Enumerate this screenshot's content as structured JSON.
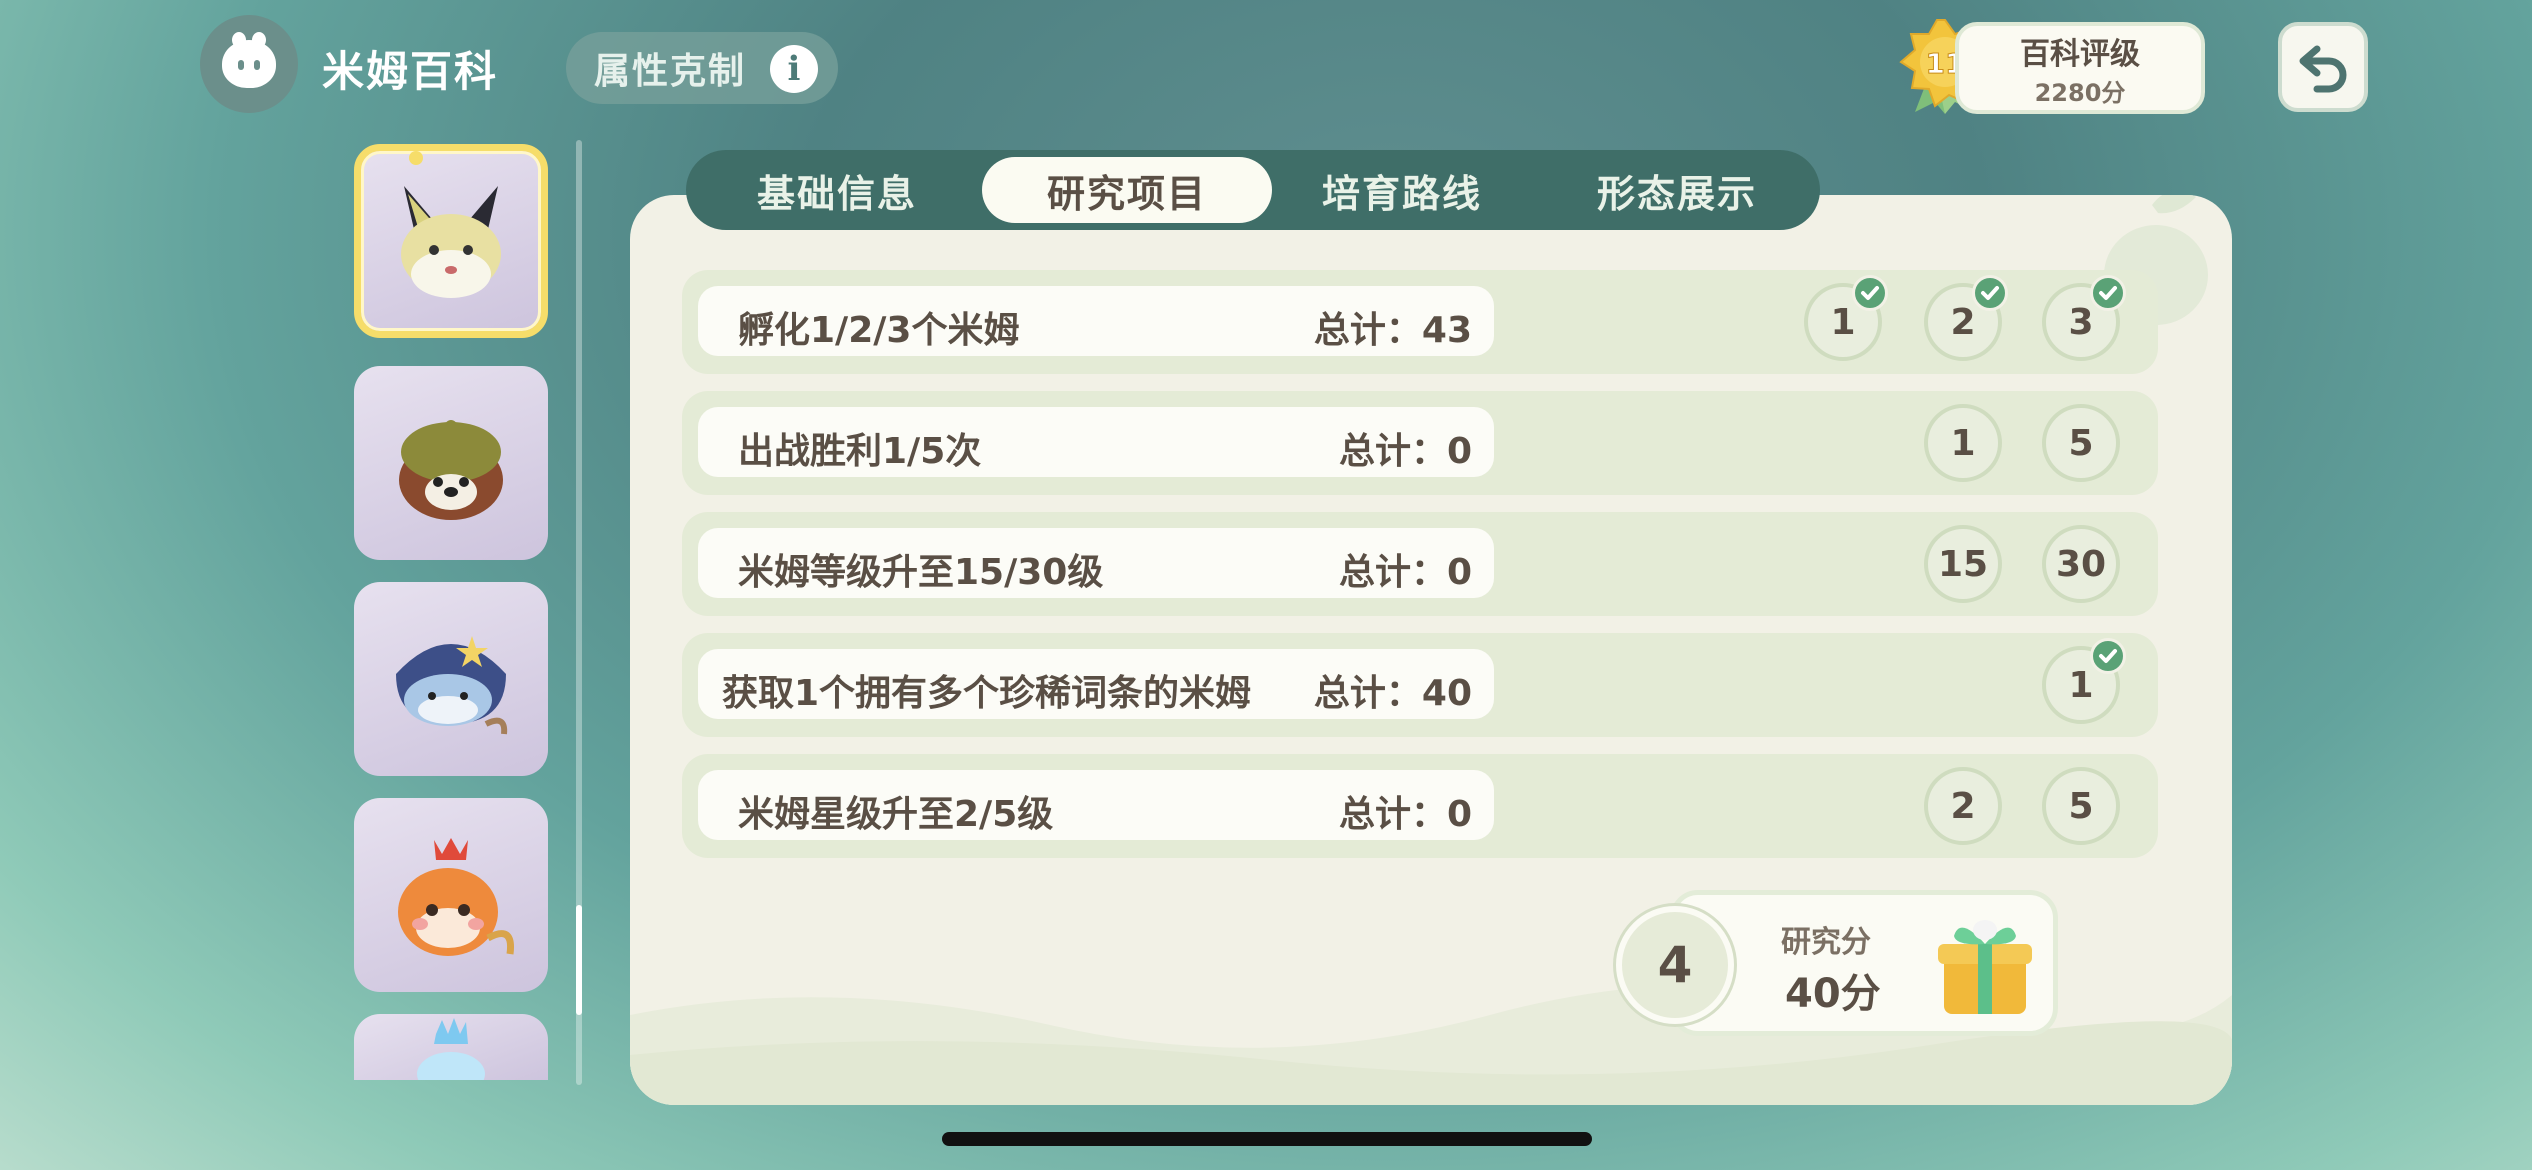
{
  "header": {
    "app_title": "米姆百科",
    "attr_button_label": "属性克制",
    "info_glyph": "i",
    "rank_level": "11",
    "rank_title": "百科评级",
    "rank_points": "2280分"
  },
  "tabs": [
    {
      "label": "基础信息",
      "active": false
    },
    {
      "label": "研究项目",
      "active": true
    },
    {
      "label": "培育路线",
      "active": false
    },
    {
      "label": "形态展示",
      "active": false
    }
  ],
  "sidebar": {
    "items": [
      {
        "name": "fox-mim",
        "selected": true
      },
      {
        "name": "leaf-bear-mim",
        "selected": false
      },
      {
        "name": "star-whale-mim",
        "selected": false
      },
      {
        "name": "crown-fox-mim",
        "selected": false
      },
      {
        "name": "ice-mim",
        "selected": false
      }
    ]
  },
  "tasks": [
    {
      "task": "孵化1/2/3个米姆",
      "total": "总计：43",
      "milestones": [
        {
          "v": "1",
          "done": true
        },
        {
          "v": "2",
          "done": true
        },
        {
          "v": "3",
          "done": true
        }
      ]
    },
    {
      "task": "出战胜利1/5次",
      "total": "总计：0",
      "milestones": [
        {
          "v": "1",
          "done": false
        },
        {
          "v": "5",
          "done": false
        }
      ]
    },
    {
      "task": "米姆等级升至15/30级",
      "total": "总计：0",
      "milestones": [
        {
          "v": "15",
          "done": false
        },
        {
          "v": "30",
          "done": false
        }
      ]
    },
    {
      "task": "获取1个拥有多个珍稀词条的米姆",
      "total": "总计：40",
      "milestones": [
        {
          "v": "1",
          "done": true
        }
      ]
    },
    {
      "task": "米姆星级升至2/5级",
      "total": "总计：0",
      "milestones": [
        {
          "v": "2",
          "done": false
        },
        {
          "v": "5",
          "done": false
        }
      ]
    }
  ],
  "score": {
    "level": "4",
    "label": "研究分",
    "value": "40分"
  },
  "colors": {
    "accent_dark": "#3f6e68",
    "panel": "#f2f1e6",
    "check": "#5aa276",
    "selected_border": "#f6dd6a"
  }
}
